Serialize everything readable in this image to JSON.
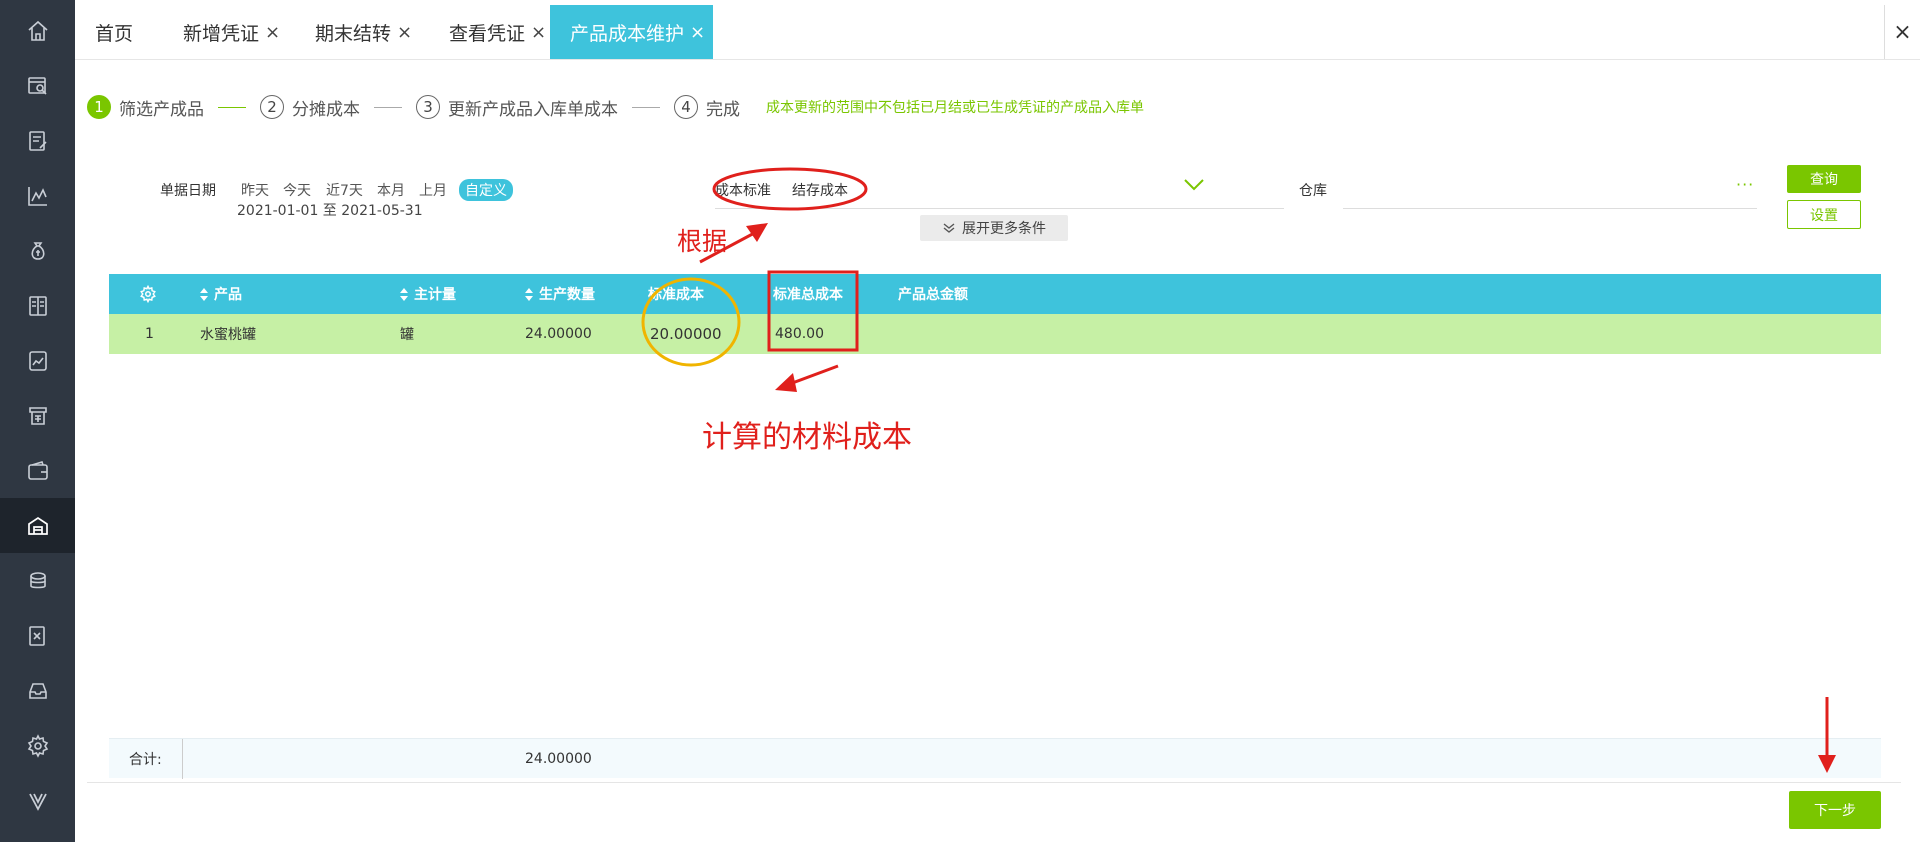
{
  "sidebar": {
    "items": [
      {
        "icon": "home-icon"
      },
      {
        "icon": "search-document-icon"
      },
      {
        "icon": "edit-voucher-icon"
      },
      {
        "icon": "chart-icon"
      },
      {
        "icon": "money-bag-icon"
      },
      {
        "icon": "ledger-icon"
      },
      {
        "icon": "report-icon"
      },
      {
        "icon": "invoice-icon"
      },
      {
        "icon": "wallet-icon"
      },
      {
        "icon": "warehouse-icon"
      },
      {
        "icon": "asset-icon"
      },
      {
        "icon": "tax-icon"
      },
      {
        "icon": "inbox-icon"
      },
      {
        "icon": "gear-icon"
      },
      {
        "icon": "v-logo-icon"
      }
    ],
    "active_index": 9
  },
  "tabs": [
    {
      "label": "首页",
      "closable": false
    },
    {
      "label": "新增凭证",
      "closable": true
    },
    {
      "label": "期末结转",
      "closable": true
    },
    {
      "label": "查看凭证",
      "closable": true
    },
    {
      "label": "产品成本维护",
      "closable": true,
      "active": true
    }
  ],
  "close_symbol": "×",
  "steps": [
    {
      "num": "1",
      "label": "筛选产成品",
      "active": true
    },
    {
      "num": "2",
      "label": "分摊成本"
    },
    {
      "num": "3",
      "label": "更新产成品入库单成本"
    },
    {
      "num": "4",
      "label": "完成"
    }
  ],
  "step_note": "成本更新的范围中不包括已月结或已生成凭证的产成品入库单",
  "filter": {
    "date_label": "单据日期",
    "date_options": [
      "昨天",
      "今天",
      "近7天",
      "本月",
      "上月",
      "自定义"
    ],
    "date_range": "2021-01-01 至 2021-05-31",
    "cost_standard_label": "成本标准",
    "cost_standard_value": "结存成本",
    "warehouse_label": "仓库",
    "warehouse_more": "···",
    "query_button": "查询",
    "setting_button": "设置",
    "expand_more": "展开更多条件"
  },
  "table": {
    "columns": [
      "产品",
      "主计量",
      "生产数量",
      "标准成本",
      "标准总成本",
      "产品总金额"
    ],
    "rows": [
      {
        "index": "1",
        "product": "水蜜桃罐",
        "unit": "罐",
        "quantity": "24.00000",
        "std_cost": "20.00000",
        "std_total": "480.00",
        "total_amount": ""
      }
    ],
    "footer_label": "合计:",
    "footer_quantity": "24.00000"
  },
  "next_button": "下一步",
  "annotations": {
    "basis": "根据",
    "material_cost": "计算的材料成本"
  },
  "colors": {
    "sidebar": "#2f3742",
    "accent_cyan": "#3ec3dc",
    "accent_green": "#7ac600",
    "row_highlight": "#c6f0a5",
    "annotation_red": "#e0201c",
    "annotation_orange": "#f0b400"
  }
}
